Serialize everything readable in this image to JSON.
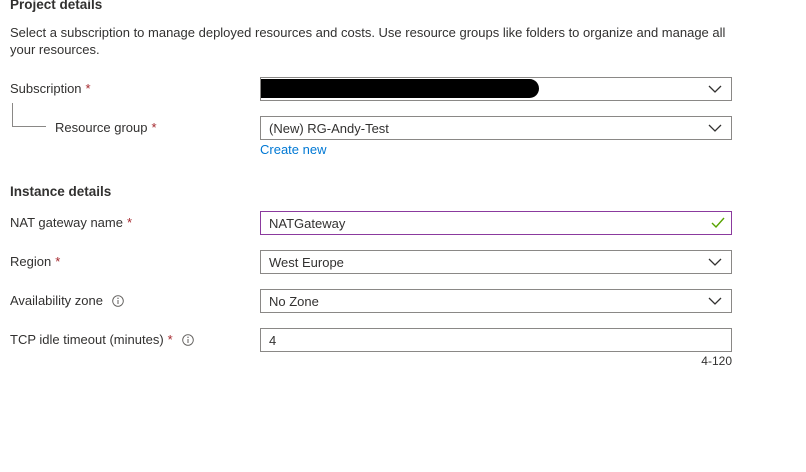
{
  "project": {
    "title": "Project details",
    "description": "Select a subscription to manage deployed resources and costs. Use resource groups like folders to organize and manage all your resources."
  },
  "subscription": {
    "label": "Subscription",
    "required": "*",
    "value": "",
    "redacted": true
  },
  "resource_group": {
    "label": "Resource group",
    "required": "*",
    "value": "(New) RG-Andy-Test",
    "create_new": "Create new"
  },
  "instance": {
    "title": "Instance details"
  },
  "nat_name": {
    "label": "NAT gateway name",
    "required": "*",
    "value": "NATGateway",
    "valid": true
  },
  "region": {
    "label": "Region",
    "required": "*",
    "value": "West Europe"
  },
  "availability_zone": {
    "label": "Availability zone",
    "value": "No Zone"
  },
  "tcp_timeout": {
    "label": "TCP idle timeout (minutes)",
    "required": "*",
    "value": "4",
    "range_hint": "4-120"
  },
  "colors": {
    "link": "#0078d4",
    "required": "#a4262c",
    "valid_border": "#8b3a9e",
    "valid_check": "#57a300"
  },
  "icons": [
    "chevron-down-icon",
    "info-icon",
    "checkmark-icon"
  ]
}
